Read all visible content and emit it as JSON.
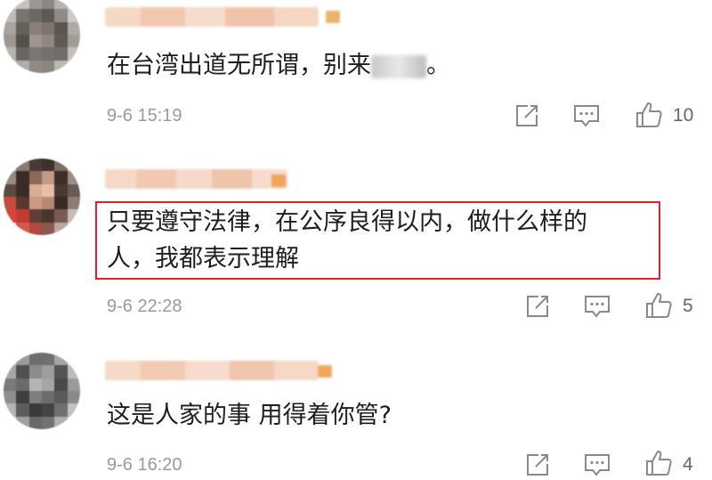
{
  "comments": [
    {
      "text_visible": "在台湾出道无所谓，别来",
      "text_tail": "。",
      "time": "9-6 15:19",
      "likes": "10"
    },
    {
      "line1": "只要遵守法律，在公序良得以内，做什么样的",
      "line2": "人，我都表示理解",
      "time": "9-6 22:28",
      "likes": "5"
    },
    {
      "text": "这是人家的事 用得着你管?",
      "time": "9-6 16:20",
      "likes": "4"
    }
  ],
  "icons": {
    "repost": "repost-icon",
    "comment": "comment-icon",
    "like": "thumbs-up-icon"
  },
  "colors": {
    "highlight_border": "#e0202a",
    "timestamp": "#9a9a9a",
    "icon": "#8a8a8a"
  }
}
